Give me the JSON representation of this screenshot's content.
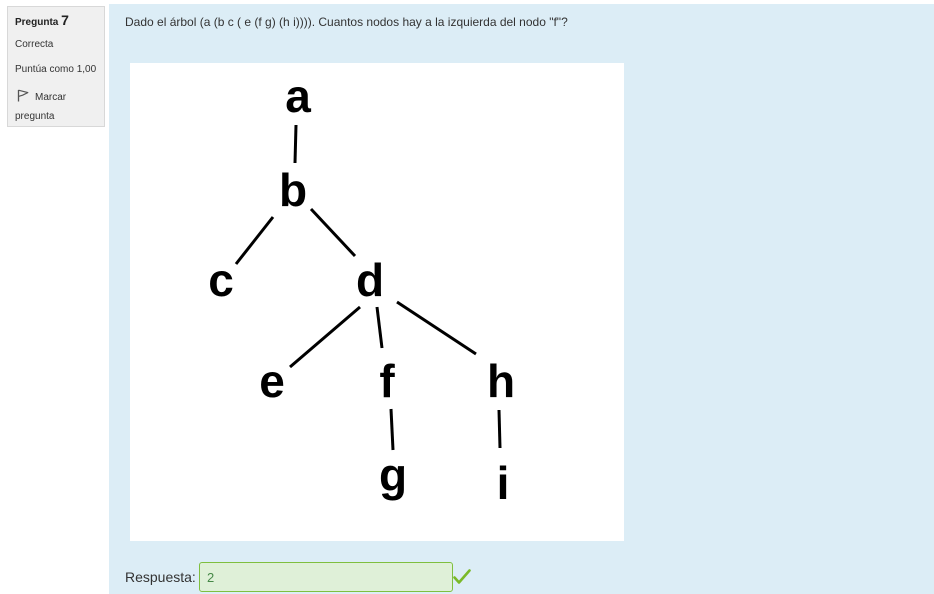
{
  "info": {
    "question_label": "Pregunta",
    "question_number": "7",
    "state": "Correcta",
    "grade": "Puntúa como 1,00",
    "flag_label": "Marcar pregunta"
  },
  "question": {
    "text": "Dado el árbol (a (b c ( e (f g) (h i)))). Cuantos nodos hay a la izquierda del nodo \"f\"?",
    "tree_nodes": [
      "a",
      "b",
      "c",
      "d",
      "e",
      "f",
      "g",
      "h",
      "i"
    ]
  },
  "answer": {
    "label": "Respuesta:",
    "value": "2",
    "status": "correct"
  },
  "icons": {
    "flag": "flag-icon",
    "feedback": "checkmark-icon"
  },
  "colors": {
    "content_background": "#dcedf6",
    "info_background": "#f0f0f0",
    "correct_fill": "#dff0d8",
    "correct_border": "#7fbf3f",
    "check": "#7ab929"
  }
}
